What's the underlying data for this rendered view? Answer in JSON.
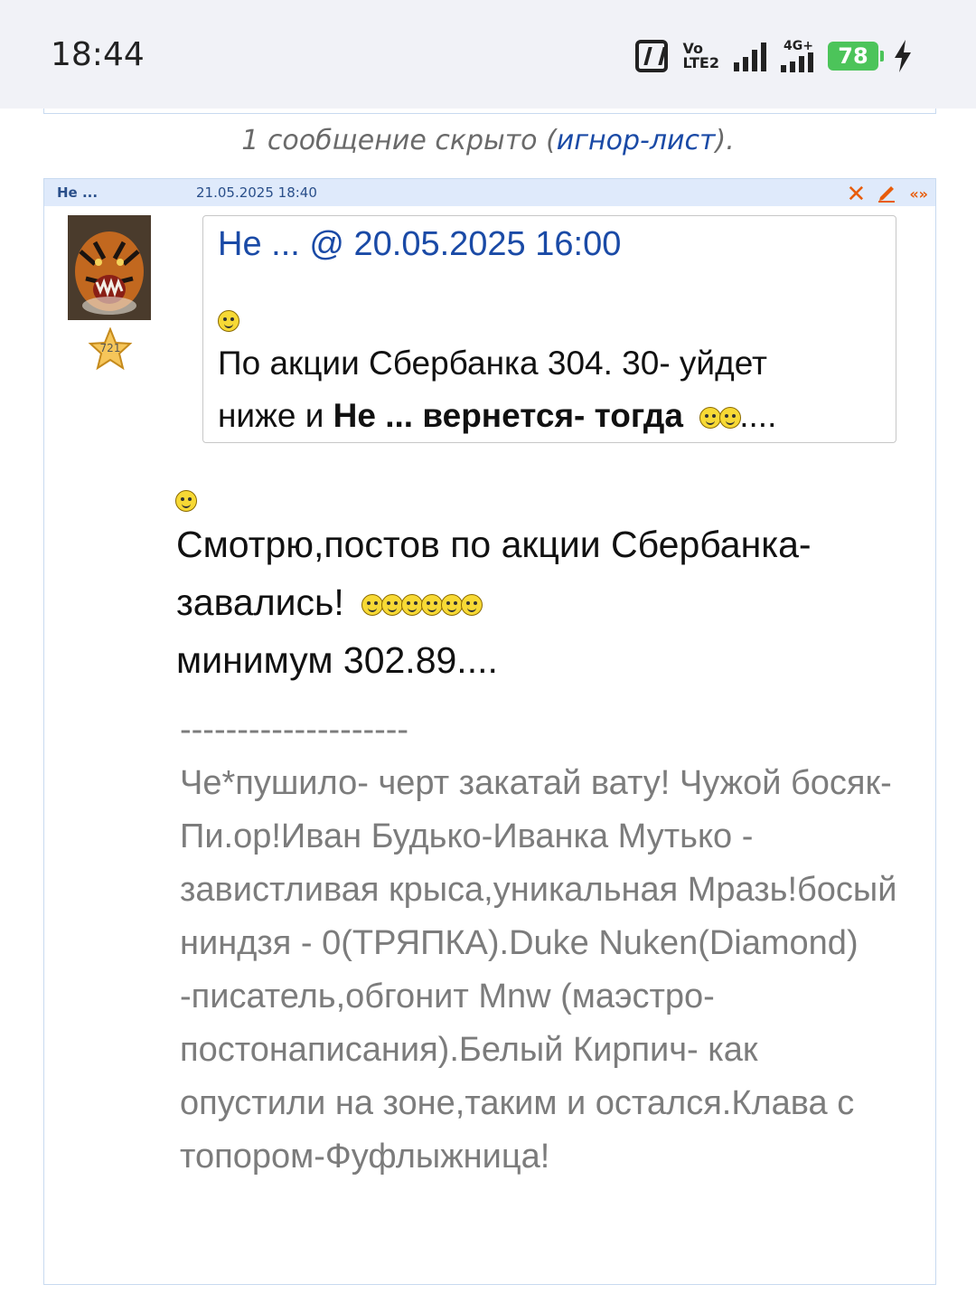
{
  "status_bar": {
    "time": "18:44",
    "volte_top": "Vo",
    "volte_bottom": "LTE2",
    "network": "4G+",
    "battery": "78"
  },
  "hidden_note": {
    "prefix": "1 сообщение скрыто (",
    "link": "игнор-лист",
    "suffix": ")."
  },
  "post": {
    "author": "Не ...",
    "date": "21.05.2025 18:40",
    "rank": "721",
    "quote": {
      "title": "Не ... @ 20.05.2025 16:00",
      "line1": "По акции Сбербанка 304. 30- уйдет",
      "line2_plain": "ниже и ",
      "line2_bold": "Не ... вернется- тогда",
      "line2_end": "...."
    },
    "body_line1": "Смотрю,постов по акции Сбербанка-",
    "body_line2": "завались!",
    "body_line3": "минимум 302.89....",
    "signature": {
      "separator": "--------------------",
      "text": "Че*пушило- черт закатай вату! Чужой босяк- Пи.ор!Иван Будько-Иванка Мутько - завистливая крыса,уникальная Мразь!босый ниндзя - 0(ТРЯПКА).Duke Nuken(Diamond) -писатель,обгонит Mnw (маэстро-постонаписания).Белый Кирпич- как опустили на зоне,таким и остался.Клава с топором-Фуфлыжница!"
    }
  },
  "icons": [
    "nfc-icon",
    "signal-icon",
    "battery-icon",
    "charging-icon",
    "delete-icon",
    "edit-icon",
    "quote-icon",
    "smiley-icon",
    "rank-star-icon"
  ]
}
